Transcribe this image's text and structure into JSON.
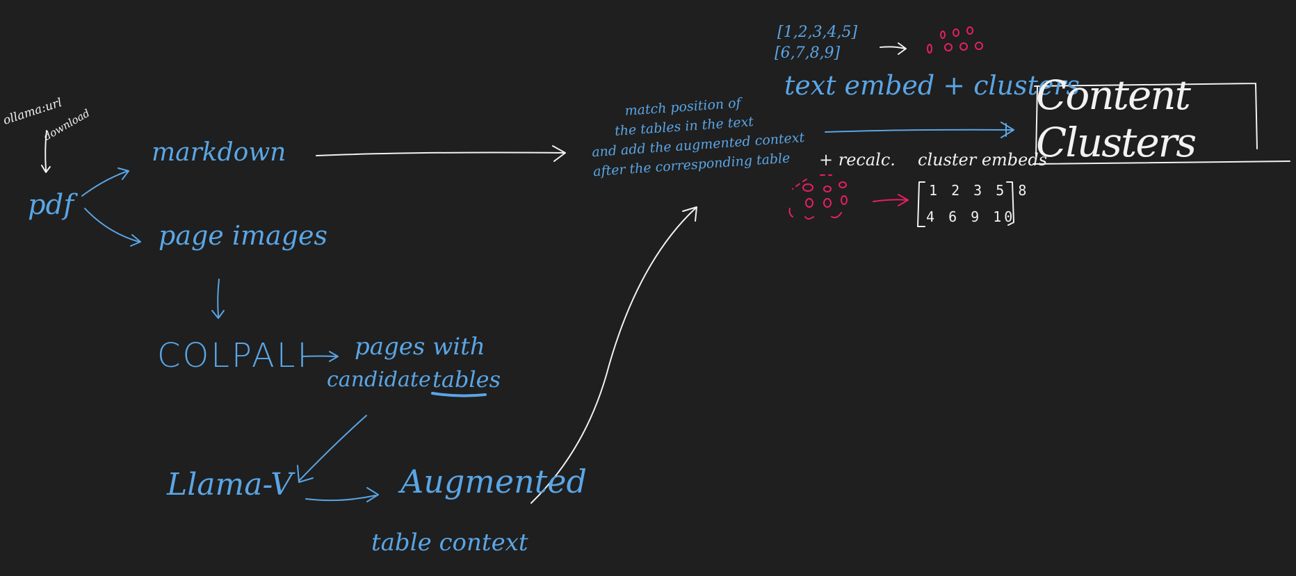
{
  "labels": {
    "ollama_line1": "ollama:url",
    "ollama_line2": "download",
    "pdf": "pdf",
    "markdown": "markdown",
    "page_images": "page images",
    "colpali": "COLPALI",
    "pages_line1": "pages with",
    "pages_line2_a": "candidate",
    "pages_line2_b": "tables",
    "llama": "Llama-V",
    "augmented_line1": "Augmented",
    "augmented_line2": "table context",
    "match_note": [
      "match position of",
      "the tables in the text",
      "and add the augmented context",
      "after the corresponding table"
    ],
    "vec_line1": "[1,2,3,4,5]",
    "vec_line2": "[6,7,8,9]",
    "text_embed": "text embed + clusters",
    "recalc": "+ recalc.",
    "cluster_embeds": "cluster embeds",
    "cluster_vec1": "1 2 3 5 8",
    "cluster_vec2": "4 6 9 10",
    "content_clusters": "Content Clusters"
  },
  "colors": {
    "background": "#1f1f1f",
    "blue_ink": "#5aa6e6",
    "white_ink": "#f2f2f2",
    "pink_ink": "#e81f63"
  }
}
